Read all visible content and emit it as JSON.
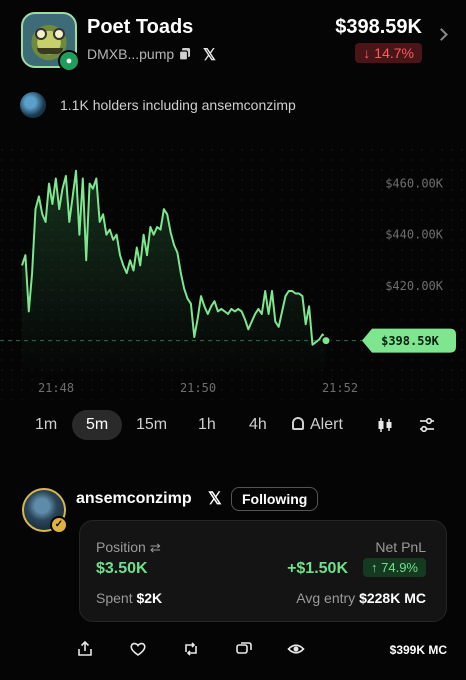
{
  "token": {
    "name": "Poet Toads",
    "address": "DMXB...pump",
    "price": "$398.59K",
    "change": "↓ 14.7%",
    "x_symbol": "𝕏"
  },
  "holders": {
    "text": "1.1K holders including ansemconzimp"
  },
  "chart_data": {
    "type": "line",
    "x_ticks": [
      "21:48",
      "21:50",
      "21:52"
    ],
    "y_ticks": [
      "$460.00K",
      "$440.00K",
      "$420.00K"
    ],
    "current_label": "$398.59K",
    "ylim": [
      391000,
      470000
    ],
    "color": "#7ee68f",
    "series": [
      {
        "values": [
          428000,
          432000,
          410000,
          425000,
          450000,
          455000,
          448000,
          445000,
          460000,
          452000,
          462000,
          450000,
          458000,
          463000,
          445000,
          455000,
          465000,
          440000,
          462000,
          430000,
          460000,
          458000,
          462000,
          445000,
          448000,
          440000,
          442000,
          438000,
          440000,
          432000,
          428000,
          425000,
          430000,
          426000,
          435000,
          428000,
          440000,
          432000,
          443000,
          440000,
          443000,
          442000,
          450000,
          448000,
          441000,
          436000,
          433000,
          425000,
          419000,
          415000,
          413000,
          400000,
          407000,
          416000,
          412000,
          409000,
          412000,
          414000,
          410000,
          411000,
          410000,
          409000,
          411000,
          410000,
          411000,
          410000,
          407000,
          403000,
          406000,
          409000,
          411000,
          409000,
          418000,
          409000,
          418000,
          406000,
          404000,
          410000,
          416000,
          418000,
          418000,
          417000,
          417000,
          416000,
          405000,
          412000,
          397000,
          398000,
          399000,
          401000,
          398590
        ]
      }
    ]
  },
  "timeframes": [
    "1m",
    "5m",
    "15m",
    "1h",
    "4h"
  ],
  "active_timeframe": "5m",
  "alert_label": "Alert",
  "user": {
    "name": "ansemconzimp",
    "x_symbol": "𝕏",
    "follow_label": "Following"
  },
  "position": {
    "position_label": "Position",
    "position_value": "$3.50K",
    "netpnl_label": "Net PnL",
    "netpnl_value": "+$1.50K",
    "netpnl_pct": "↑ 74.9%",
    "spent_label": "Spent",
    "spent_value": "$2K",
    "avg_label": "Avg entry",
    "avg_value": "$228K MC"
  },
  "market_cap": "$399K  MC",
  "colors": {
    "up": "#6fe08a",
    "down": "#ff5a5f",
    "bg": "#050505"
  }
}
